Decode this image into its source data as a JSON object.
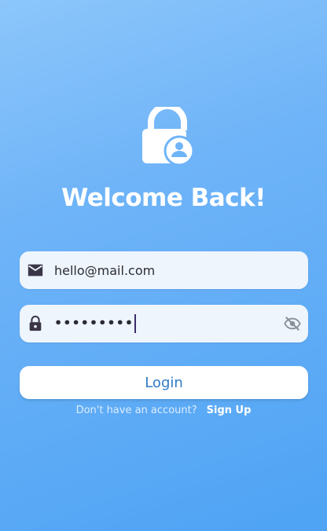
{
  "header": {
    "title": "Welcome Back!",
    "icon": "lock-user-icon"
  },
  "form": {
    "email": {
      "value": "hello@mail.com",
      "icon": "mail-icon"
    },
    "password": {
      "masked_value": "•••••••••",
      "icon": "lock-icon",
      "toggle_icon": "eye-off-icon"
    },
    "login_label": "Login"
  },
  "footer": {
    "prompt": "Don't have an account?",
    "signup_label": "Sign Up"
  },
  "colors": {
    "background_top": "#8cc6fb",
    "background_bottom": "#4ea3f4",
    "field_bg": "#eef5fd",
    "button_text": "#2f7bc8",
    "text_white": "#ffffff"
  }
}
